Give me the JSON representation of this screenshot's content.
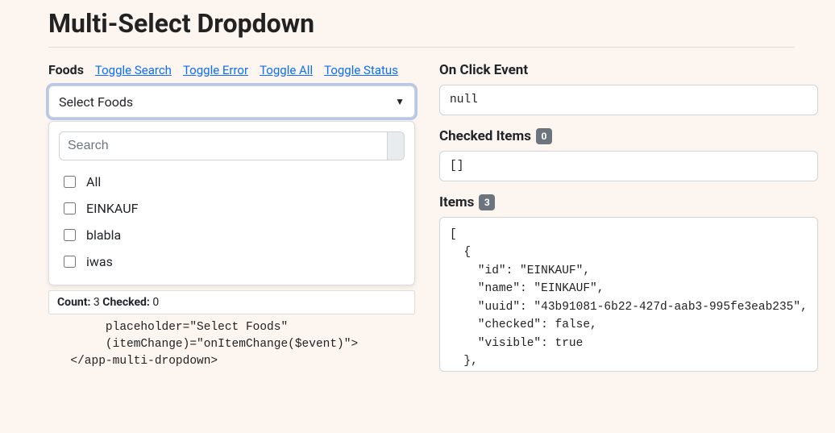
{
  "page": {
    "title": "Multi-Select Dropdown"
  },
  "left": {
    "label": "Foods",
    "toggles": {
      "search": "Toggle Search",
      "error": "Toggle Error",
      "all": "Toggle All",
      "status": "Toggle Status"
    },
    "dropdown": {
      "placeholder": "Select Foods",
      "search_placeholder": "Search",
      "options": {
        "all": "All",
        "o1": "EINKAUF",
        "o2": "blabla",
        "o3": "iwas"
      }
    },
    "status": {
      "count_label": "Count:",
      "count_value": "3",
      "checked_label": "Checked:",
      "checked_value": "0"
    },
    "code": "       placeholder=\"Select Foods\"\n       (itemChange)=\"onItemChange($event)\">\n  </app-multi-dropdown>"
  },
  "right": {
    "click_event": {
      "label": "On Click Event",
      "value": "null"
    },
    "checked_items": {
      "label": "Checked Items",
      "badge": "0",
      "value": "[]"
    },
    "items": {
      "label": "Items",
      "badge": "3",
      "json": "[\n  {\n    \"id\": \"EINKAUF\",\n    \"name\": \"EINKAUF\",\n    \"uuid\": \"43b91081-6b22-427d-aab3-995fe3eab235\",\n    \"checked\": false,\n    \"visible\": true\n  },\n  {"
    }
  }
}
